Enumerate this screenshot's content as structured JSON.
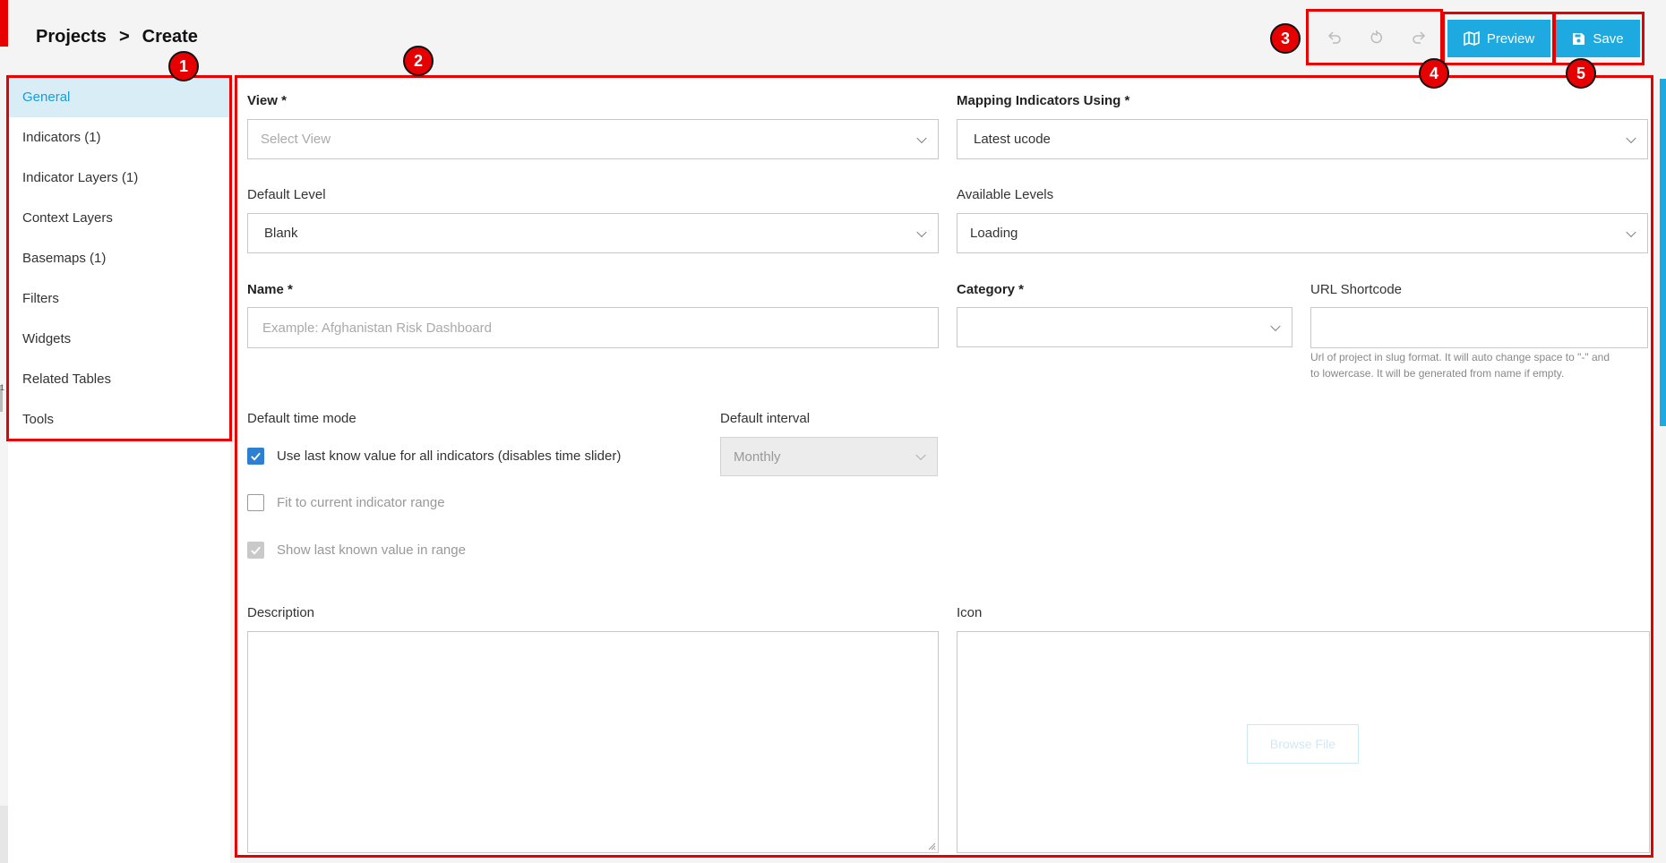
{
  "breadcrumb": {
    "parent": "Projects",
    "separator": ">",
    "current": "Create"
  },
  "sidebar": {
    "items": [
      {
        "label": "General",
        "active": true
      },
      {
        "label": "Indicators (1)"
      },
      {
        "label": "Indicator Layers (1)"
      },
      {
        "label": "Context Layers"
      },
      {
        "label": "Basemaps (1)"
      },
      {
        "label": "Filters"
      },
      {
        "label": "Widgets"
      },
      {
        "label": "Related Tables"
      },
      {
        "label": "Tools"
      }
    ]
  },
  "toolbar": {
    "preview_label": "Preview",
    "save_label": "Save"
  },
  "form": {
    "view": {
      "label": "View *",
      "placeholder": "Select View"
    },
    "mapping": {
      "label": "Mapping Indicators Using *",
      "value": "Latest ucode"
    },
    "default_level": {
      "label": "Default Level",
      "value": "Blank"
    },
    "available_levels": {
      "label": "Available Levels",
      "value": "Loading"
    },
    "name": {
      "label": "Name *",
      "placeholder": "Example: Afghanistan Risk Dashboard"
    },
    "category": {
      "label": "Category *",
      "value": ""
    },
    "url_shortcode": {
      "label": "URL Shortcode",
      "value": "",
      "hint_line1": "Url of project in slug format. It will auto change space to \"-\" and",
      "hint_line2": "to lowercase. It will be generated from name if empty."
    },
    "default_time_mode": {
      "label": "Default time mode"
    },
    "default_interval": {
      "label": "Default interval",
      "value": "Monthly"
    },
    "checkboxes": [
      {
        "label": "Use last know value for all indicators (disables time slider)",
        "checked": true
      },
      {
        "label": "Fit to current indicator range",
        "checked": false
      },
      {
        "label": "Show last known value in range",
        "checked": true
      }
    ],
    "description": {
      "label": "Description"
    },
    "icon": {
      "label": "Icon",
      "browse_label": "Browse File"
    }
  },
  "annotations": {
    "m1": "1",
    "m2": "2",
    "m3": "3",
    "m4": "4",
    "m5": "5"
  },
  "colors": {
    "accent": "#1fa9e1",
    "annotation_red": "#e60000",
    "active_bg": "#d9edf7",
    "checkbox_blue": "#2d7fd0"
  },
  "left_edge_glyph": "1"
}
